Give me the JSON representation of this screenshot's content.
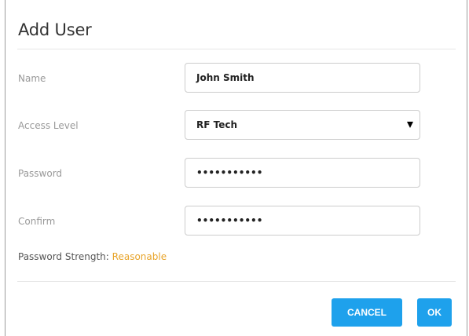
{
  "dialog": {
    "title": "Add User",
    "fields": {
      "name": {
        "label": "Name",
        "value": "John Smith"
      },
      "access_level": {
        "label": "Access Level",
        "value": "RF Tech"
      },
      "password": {
        "label": "Password",
        "value": "•••••••••••"
      },
      "confirm": {
        "label": "Confirm",
        "value": "•••••••••••"
      }
    },
    "strength": {
      "label": "Password Strength:",
      "value": "Reasonable"
    },
    "buttons": {
      "cancel": "CANCEL",
      "ok": "OK"
    }
  },
  "colors": {
    "accent": "#1ea1ec",
    "strength_reasonable": "#e8a42a",
    "label_text": "#999999"
  },
  "icons": {
    "dropdown": "caret-down-icon"
  }
}
